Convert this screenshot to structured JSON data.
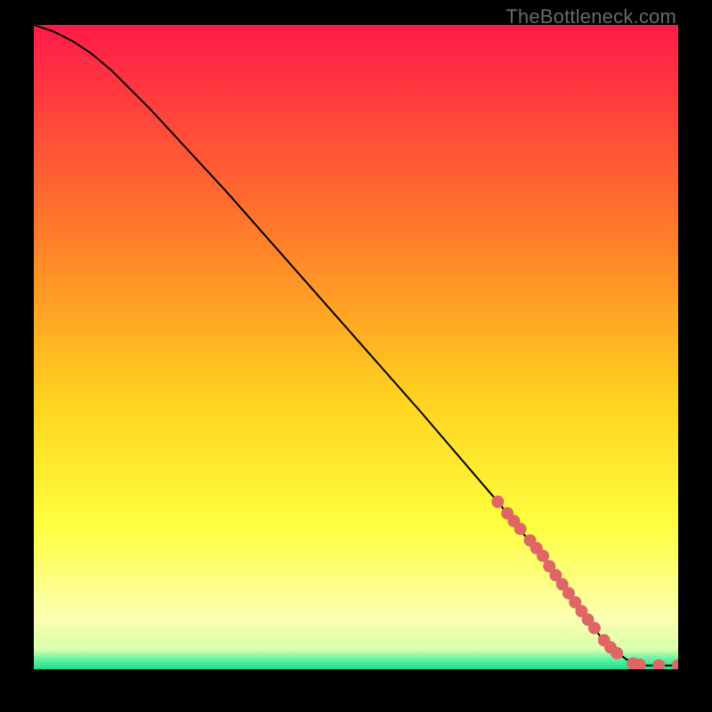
{
  "attribution": "TheBottleneck.com",
  "colors": {
    "gradient_top": "#ff1a49",
    "gradient_mid1": "#ff7a2a",
    "gradient_mid2": "#ffd21f",
    "gradient_mid3": "#ffff40",
    "gradient_mid4": "#fbffb0",
    "gradient_bottom_band": "#19e08a",
    "curve": "#000000",
    "marker": "#e06666",
    "frame": "#000000"
  },
  "chart_data": {
    "type": "line",
    "title": "",
    "xlabel": "",
    "ylabel": "",
    "xlim": [
      0,
      100
    ],
    "ylim": [
      0,
      100
    ],
    "series": [
      {
        "name": "bottleneck-curve",
        "x": [
          0,
          3,
          6,
          9,
          12,
          18,
          30,
          45,
          60,
          72,
          80,
          85,
          88,
          90,
          92,
          95,
          100
        ],
        "y": [
          100,
          99,
          97.5,
          95.5,
          93,
          87,
          74,
          57,
          40,
          26,
          16,
          9,
          5,
          3,
          1.5,
          0.6,
          0.6
        ]
      }
    ],
    "markers": {
      "name": "highlighted-points",
      "x": [
        72,
        73.5,
        74.5,
        75.5,
        77,
        78,
        79,
        80,
        81,
        82,
        83,
        84,
        85,
        86,
        87,
        88.5,
        89.5,
        90.5,
        93,
        94,
        97,
        100
      ],
      "y": [
        26,
        24.2,
        23,
        21.8,
        20,
        18.8,
        17.6,
        16,
        14.6,
        13.2,
        11.8,
        10.4,
        9,
        7.7,
        6.4,
        4.5,
        3.4,
        2.5,
        0.9,
        0.7,
        0.6,
        0.6
      ]
    }
  }
}
